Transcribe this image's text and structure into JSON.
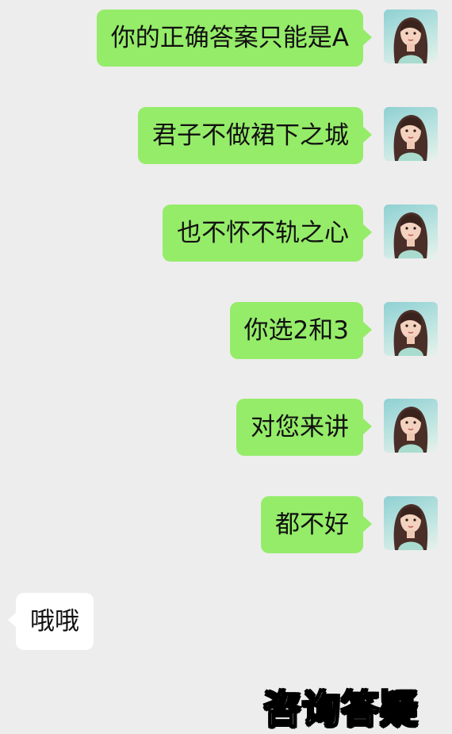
{
  "messages": [
    {
      "side": "right",
      "text": "你的正确答案只能是A"
    },
    {
      "side": "right",
      "text": "君子不做裙下之城"
    },
    {
      "side": "right",
      "text": "也不怀不轨之心"
    },
    {
      "side": "right",
      "text": "你选2和3"
    },
    {
      "side": "right",
      "text": "对您来讲"
    },
    {
      "side": "right",
      "text": "都不好"
    },
    {
      "side": "left",
      "text": "哦哦"
    }
  ],
  "watermark": "咨询答疑",
  "colors": {
    "background": "#ededed",
    "outgoing_bubble": "#95ec69",
    "incoming_bubble": "#ffffff"
  }
}
